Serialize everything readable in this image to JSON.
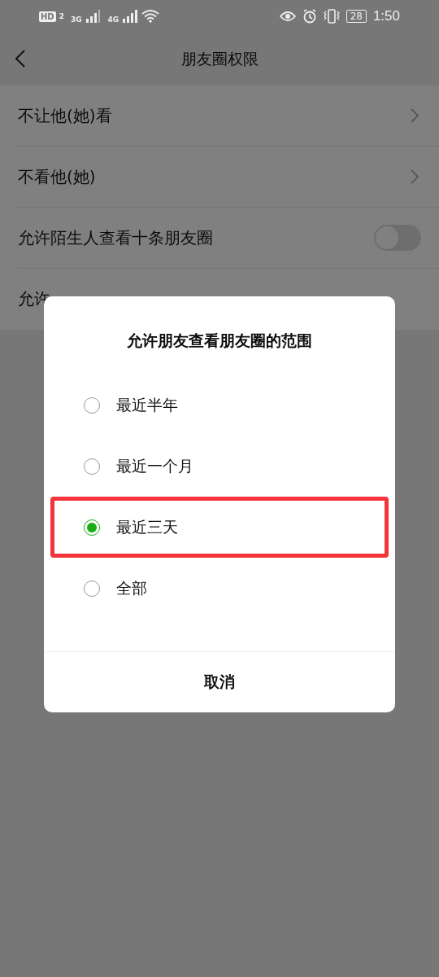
{
  "status_bar": {
    "hd": "HD",
    "sim": "2",
    "net1": "3G",
    "net2": "4G",
    "battery": "28",
    "time": "1:50"
  },
  "header": {
    "title": "朋友圈权限"
  },
  "rows": [
    {
      "kind": "link",
      "label": "不让他(她)看"
    },
    {
      "kind": "link",
      "label": "不看他(她)"
    },
    {
      "kind": "toggle",
      "label": "允许陌生人查看十条朋友圈",
      "on": false
    },
    {
      "kind": "partial",
      "label": "允许"
    }
  ],
  "dialog": {
    "title": "允许朋友查看朋友圈的范围",
    "options": [
      {
        "label": "最近半年",
        "selected": false,
        "highlighted": false
      },
      {
        "label": "最近一个月",
        "selected": false,
        "highlighted": false
      },
      {
        "label": "最近三天",
        "selected": true,
        "highlighted": true
      },
      {
        "label": "全部",
        "selected": false,
        "highlighted": false
      }
    ],
    "cancel": "取消"
  }
}
